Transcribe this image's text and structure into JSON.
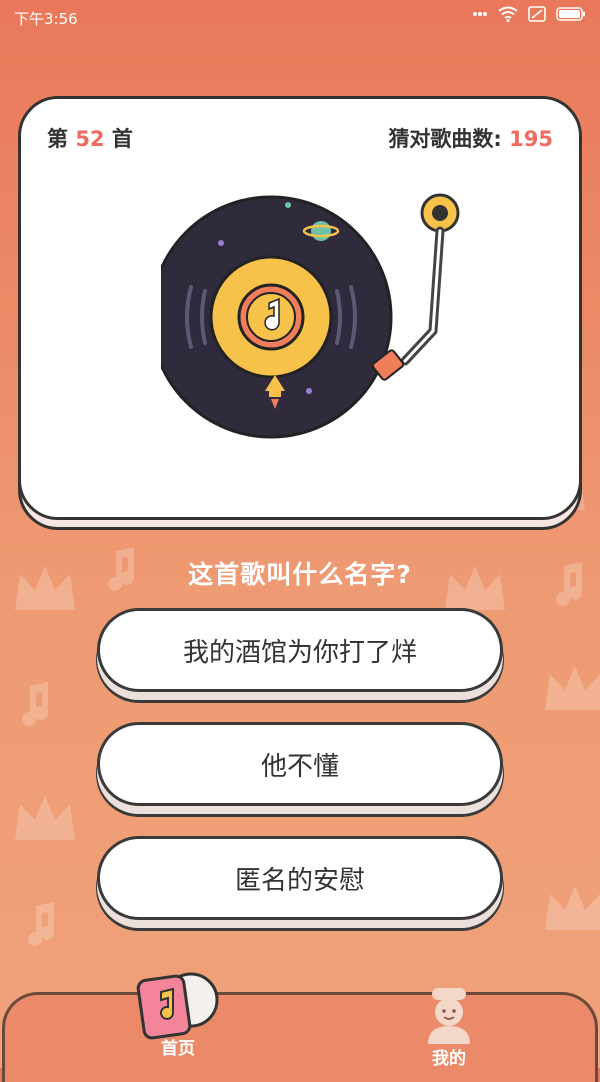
{
  "status": {
    "time": "下午3:56"
  },
  "card": {
    "prefix": "第",
    "number": "52",
    "suffix": "首",
    "score_label": "猜对歌曲数:",
    "score_value": "195"
  },
  "question": "这首歌叫什么名字?",
  "answers": [
    {
      "label": "我的酒馆为你打了烊"
    },
    {
      "label": "他不懂"
    },
    {
      "label": "匿名的安慰"
    }
  ],
  "tabs": [
    {
      "label": "首页",
      "active": true
    },
    {
      "label": "我的",
      "active": false
    }
  ],
  "colors": {
    "accent": "#f06b5e",
    "background_top": "#e9785a",
    "background_bottom": "#f0a27a",
    "record": "#2f2a3c",
    "record_label": "#f7c24a"
  }
}
